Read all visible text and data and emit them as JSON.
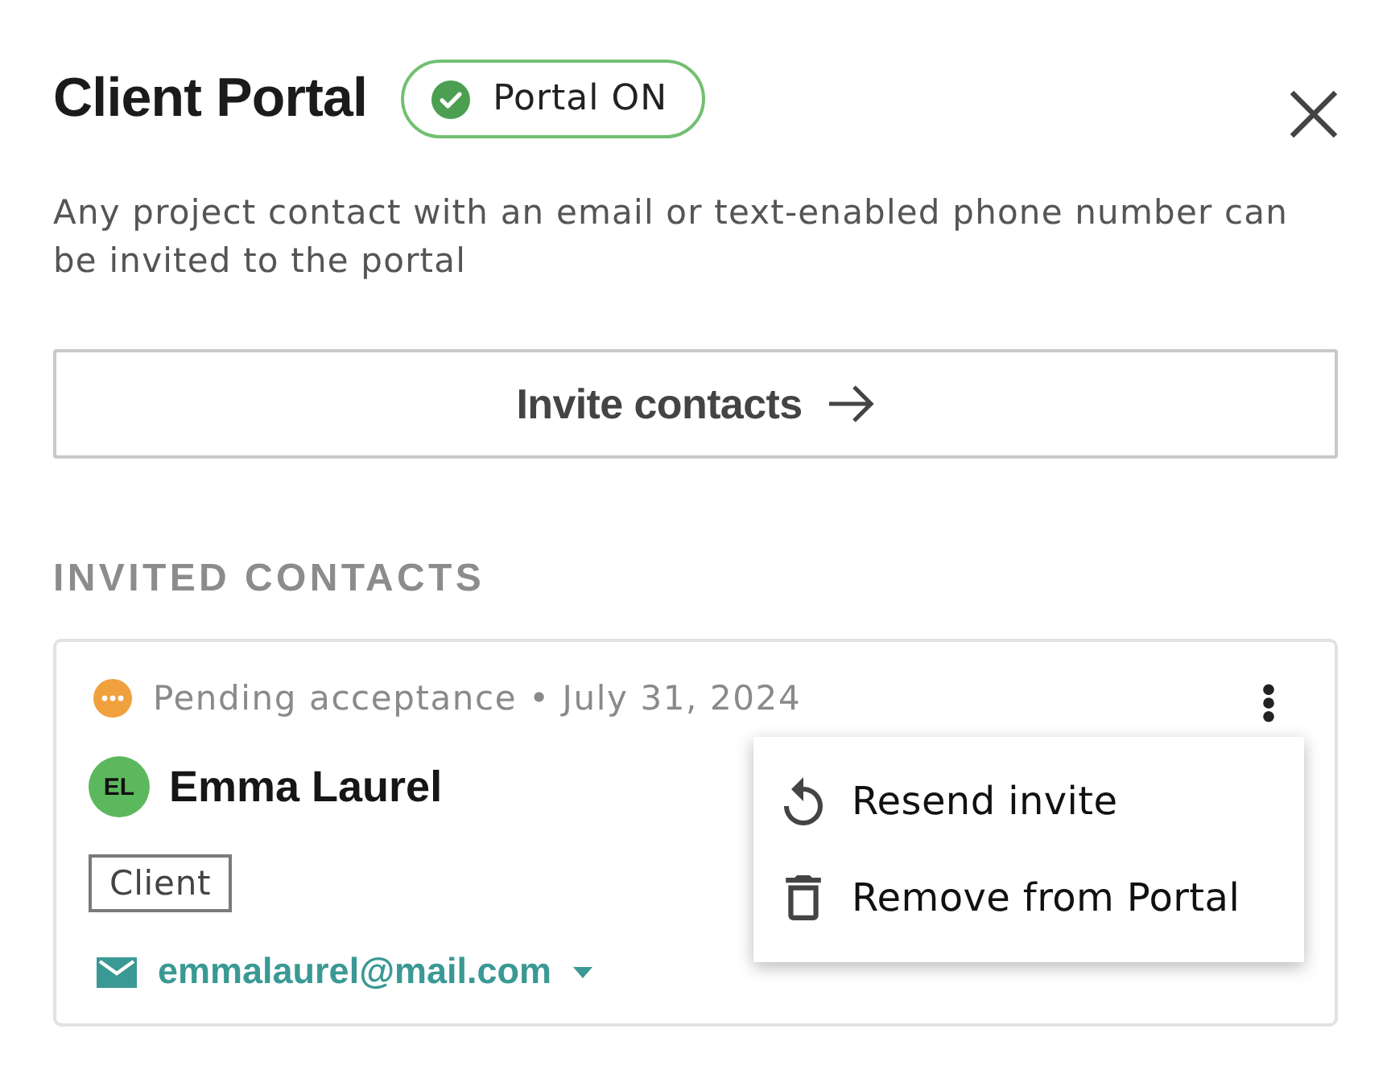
{
  "header": {
    "title": "Client Portal",
    "status_badge": {
      "label": "Portal ON",
      "on": true
    }
  },
  "description": "Any project contact with an email or text-enabled phone number can be invited to the portal",
  "invite_button": {
    "label": "Invite contacts"
  },
  "invited_contacts": {
    "heading": "INVITED CONTACTS",
    "contacts": [
      {
        "status": {
          "kind": "pending",
          "text": "Pending acceptance • July 31, 2024"
        },
        "initials": "EL",
        "name": "Emma Laurel",
        "role": "Client",
        "email": "emmalaurel@mail.com",
        "menu": {
          "open": true,
          "items": [
            {
              "kind": "resend",
              "label": "Resend invite"
            },
            {
              "kind": "remove",
              "label": "Remove from Portal"
            }
          ]
        }
      }
    ]
  }
}
